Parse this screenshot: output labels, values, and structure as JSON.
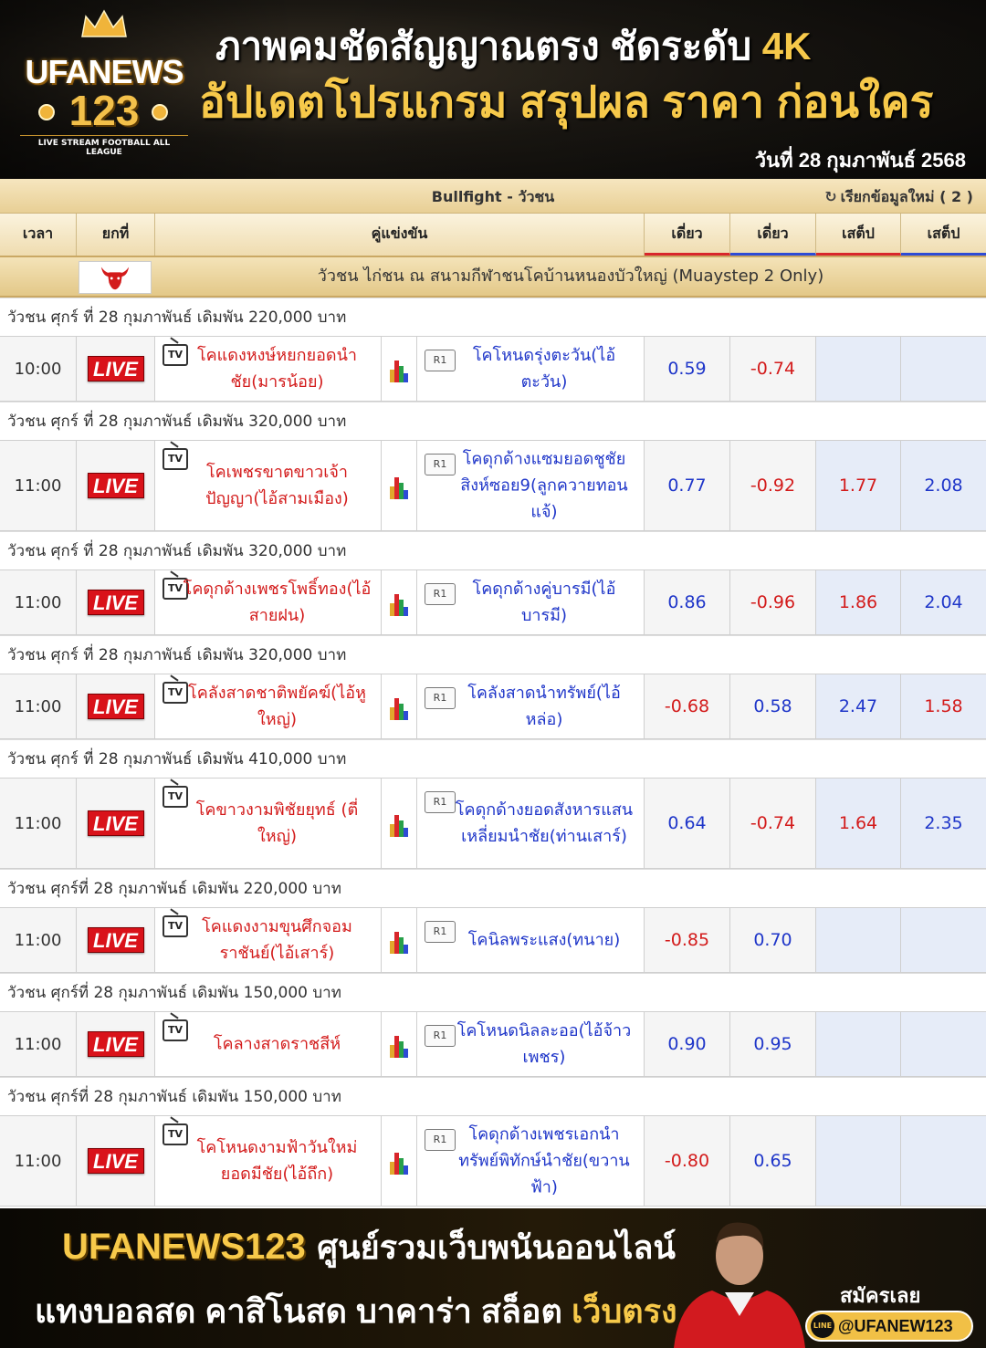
{
  "header": {
    "logo_line1": "UFANEWS",
    "logo_line2": "123",
    "logo_tagline": "LIVE STREAM FOOTBALL ALL LEAGUE",
    "headline1": "ภาพคมชัดสัญญาณตรง ชัดระดับ",
    "headline1_highlight": "4K",
    "headline2": "อัปเดตโปรแกรม สรุปผล ราคา ก่อนใคร",
    "date": "วันที่ 28 กุมภาพันธ์ 2568"
  },
  "toolbar": {
    "title": "Bullfight - วัวชน",
    "refresh_label": "เรียกข้อมูลใหม่ ( 2 )"
  },
  "columns": {
    "time": "เวลา",
    "round": "ยกที่",
    "match": "คู่แข่งขัน",
    "odd1": "เดี่ยว",
    "odd2": "เดี่ยว",
    "odd3": "เสต็ป",
    "odd4": "เสต็ป"
  },
  "league": {
    "name": "วัวชน ไก่ชน ณ สนามกีฬาชนโคบ้านหนองบัวใหญ่ (Muaystep 2 Only)"
  },
  "tv_label": "TV",
  "round_label": "R1",
  "live_label": "LIVE",
  "matches": [
    {
      "info": "วัวชน ศุกร์ ที่ 28 กุมภาพันธ์ เดิมพัน 220,000 บาท",
      "time": "10:00",
      "home": "โคแดงหงษ์หยกยอดนำชัย(มารน้อย)",
      "away": "โคโหนดรุ่งตะวัน(ไอ้ตะวัน)",
      "o1": "0.59",
      "o2": "-0.74",
      "o3": "",
      "o4": ""
    },
    {
      "info": "วัวชน ศุกร์ ที่ 28 กุมภาพันธ์ เดิมพัน 320,000 บาท",
      "time": "11:00",
      "home": "โคเพชรขาตขาวเจ้าปัญญา(ไอ้สามเมือง)",
      "away": "โคดุกด้างแซมยอดชูชัยสิงห์ซอย9(ลูกควายทอนแจ้)",
      "o1": "0.77",
      "o2": "-0.92",
      "o3": "1.77",
      "o4": "2.08"
    },
    {
      "info": "วัวชน ศุกร์ ที่ 28 กุมภาพันธ์ เดิมพัน 320,000 บาท",
      "time": "11:00",
      "home": "โคดุกด้างเพชรโพธิ์ทอง(ไอ้สายฝน)",
      "away": "โคดุกด้างคู่บารมี(ไอ้บารมี)",
      "o1": "0.86",
      "o2": "-0.96",
      "o3": "1.86",
      "o4": "2.04"
    },
    {
      "info": "วัวชน ศุกร์ ที่ 28 กุมภาพันธ์ เดิมพัน 320,000 บาท",
      "time": "11:00",
      "home": "โคลังสาดชาติพยัคฆ์(ไอ้หูใหญ่)",
      "away": "โคลังสาดนำทรัพย์(ไอ้หล่อ)",
      "o1": "-0.68",
      "o2": "0.58",
      "o3": "2.47",
      "o4": "1.58"
    },
    {
      "info": "วัวชน ศุกร์ ที่ 28 กุมภาพันธ์ เดิมพัน 410,000 บาท",
      "time": "11:00",
      "home": "โคขาวงามพิชัยยุทธ์ (ตี่ใหญ่)",
      "away": "โคดุกด้างยอดสังหารแสนเหลี่ยมนำชัย(ท่านเสาร์)",
      "o1": "0.64",
      "o2": "-0.74",
      "o3": "1.64",
      "o4": "2.35"
    },
    {
      "info": "วัวชน ศุกร์ที่ 28 กุมภาพันธ์ เดิมพัน 220,000 บาท",
      "time": "11:00",
      "home": "โคแดงงามขุนศึกจอมราชันย์(ไอ้เสาร์)",
      "away": "โคนิลพระแสง(ทนาย)",
      "o1": "-0.85",
      "o2": "0.70",
      "o3": "",
      "o4": ""
    },
    {
      "info": "วัวชน ศุกร์ที่ 28 กุมภาพันธ์ เดิมพัน 150,000 บาท",
      "time": "11:00",
      "home": "โคลางสาดราชสีห์",
      "away": "โคโหนดนิลละออ(ไอ้จ้าวเพชร)",
      "o1": "0.90",
      "o2": "0.95",
      "o3": "",
      "o4": ""
    },
    {
      "info": "วัวชน ศุกร์ที่ 28 กุมภาพันธ์ เดิมพัน 150,000 บาท",
      "time": "11:00",
      "home": "โคโหนดงามฟ้าวันใหม่ยอดมีชัย(ไอ้ถึก)",
      "away": "โคดุกด้างเพชรเอกนำทรัพย์พิทักษ์นำชัย(ขวานฟ้า)",
      "o1": "-0.80",
      "o2": "0.65",
      "o3": "",
      "o4": ""
    }
  ],
  "footer": {
    "brand": "UFANEWS123",
    "line1": "ศูนย์รวมเว็บพนันออนไลน์",
    "line2": "แทงบอลสด คาสิโนสด บาคาร่า สล็อต",
    "line2_highlight": "เว็บตรง",
    "subscribe": "สมัครเลย",
    "line_id": "@UFANEW123",
    "line_icon_label": "LINE"
  },
  "colors": {
    "positive": "#1f36c9",
    "negative": "#d31b1b",
    "live": "#d9121a",
    "gold": "#f7c94a"
  }
}
